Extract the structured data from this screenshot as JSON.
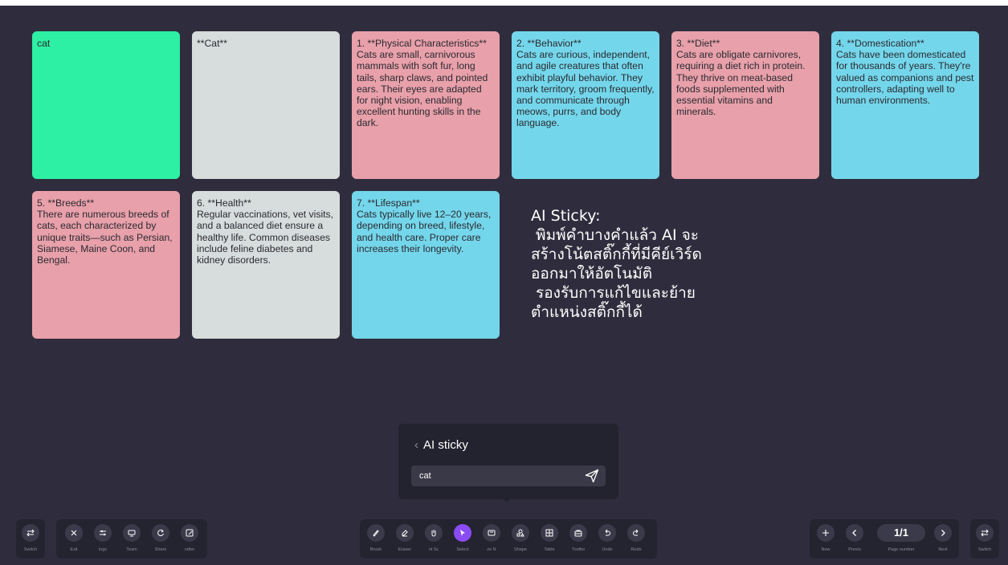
{
  "notes": [
    {
      "text": "cat",
      "color": "#2ef0a4"
    },
    {
      "text": "**Cat**",
      "color": "#d7dcdd"
    },
    {
      "text": "1. **Physical Characteristics**\nCats are small, carnivorous mammals with soft fur, long tails, sharp claws, and pointed ears. Their eyes are adapted for night vision, enabling excellent hunting skills in the dark.",
      "color": "#e8a0aa"
    },
    {
      "text": "2. **Behavior**\nCats are curious, independent, and agile creatures that often exhibit playful behavior. They mark territory, groom frequently, and communicate through meows, purrs, and body language.",
      "color": "#74d6eb"
    },
    {
      "text": "3. **Diet**\nCats are obligate carnivores, requiring a diet rich in protein. They thrive on meat-based foods supplemented with essential vitamins and minerals.",
      "color": "#e8a0aa"
    },
    {
      "text": "4. **Domestication**\nCats have been domesticated for thousands of years. They're valued as companions and pest controllers, adapting well to human environments.",
      "color": "#74d6eb"
    },
    {
      "text": "5. **Breeds**\nThere are numerous breeds of cats, each characterized by unique traits—such as Persian, Siamese, Maine Coon, and Bengal.",
      "color": "#e8a0aa"
    },
    {
      "text": "6. **Health**\nRegular vaccinations, vet visits, and a balanced diet ensure a healthy life. Common diseases include feline diabetes and kidney disorders.",
      "color": "#d7dcdd"
    },
    {
      "text": "7. **Lifespan**\nCats typically live 12–20 years, depending on breed, lifestyle, and health care. Proper care increases their longevity.",
      "color": "#74d6eb"
    }
  ],
  "ai_description": "AI Sticky:\n พิมพ์คำบางคำแล้ว AI จะ\nสร้างโน้ตสติ๊กกี้ที่มีคีย์เวิร์ด\nออกมาให้อัตโนมัติ\n รองรับการแก้ไขและย้าย\nตำแหน่งสติ๊กกี้ได้",
  "ai_panel": {
    "back_icon": "chevron-left-icon",
    "title": "AI sticky",
    "input_value": "cat",
    "send_icon": "send-icon"
  },
  "toolbar_left": {
    "switch": {
      "label": "Switch",
      "icon": "switch-icon"
    },
    "items": [
      {
        "label": "Exit",
        "icon": "close-icon"
      },
      {
        "label": "ings",
        "icon": "sliders-icon"
      },
      {
        "label": "Team",
        "icon": "screen-icon"
      },
      {
        "label": "Share",
        "icon": "share-icon"
      },
      {
        "label": "ndbo",
        "icon": "edit-icon"
      }
    ]
  },
  "toolbar_center": [
    {
      "label": "Brush",
      "icon": "brush-icon"
    },
    {
      "label": "Eraser",
      "icon": "eraser-icon"
    },
    {
      "label": "nt  Sc",
      "icon": "hand-icon"
    },
    {
      "label": "Select",
      "icon": "select-icon",
      "active": true
    },
    {
      "label": "ze  N",
      "icon": "sticky-note-icon"
    },
    {
      "label": "Shape",
      "icon": "shape-icon"
    },
    {
      "label": "Table",
      "icon": "table-icon"
    },
    {
      "label": "Toolbo",
      "icon": "toolbox-icon"
    },
    {
      "label": "Undo",
      "icon": "undo-icon"
    },
    {
      "label": "Redo",
      "icon": "redo-icon"
    }
  ],
  "toolbar_right": {
    "new": {
      "label": "New",
      "icon": "plus-icon"
    },
    "previous": {
      "label": "Previo",
      "icon": "chevron-left-icon"
    },
    "page": {
      "value": "1/1",
      "label": "Page number"
    },
    "next": {
      "label": "Next",
      "icon": "chevron-right-icon"
    },
    "switch": {
      "label": "Switch",
      "icon": "switch-icon"
    }
  },
  "colors": {
    "board": "#2f2d3d",
    "toolbar": "#242330",
    "active": "#8a4cf5"
  }
}
